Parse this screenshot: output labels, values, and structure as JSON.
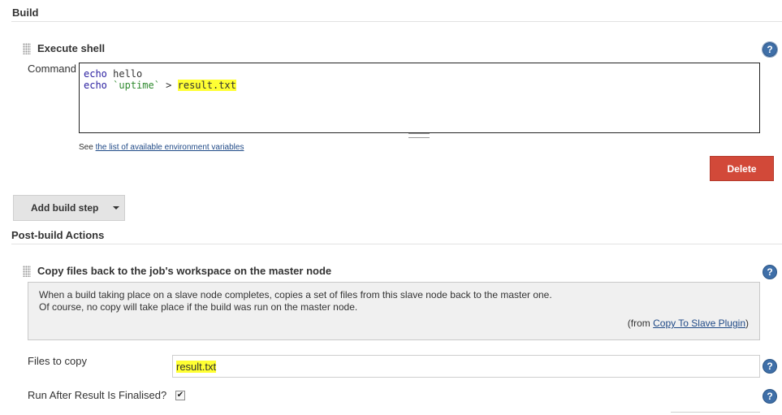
{
  "build": {
    "section_title": "Build",
    "step": {
      "title": "Execute shell",
      "command_label": "Command",
      "code": {
        "line1_cmd": "echo",
        "line1_arg": " hello",
        "line2_cmd": "echo",
        "line2_str": "`uptime`",
        "line2_op": " > ",
        "line2_file": "result.txt"
      },
      "hint_prefix": "See ",
      "hint_link": "the list of available environment variables",
      "delete_label": "Delete"
    },
    "add_step_label": "Add build step"
  },
  "post_build": {
    "section_title": "Post-build Actions",
    "action": {
      "title": "Copy files back to the job's workspace on the master node",
      "desc_line1": "When a build taking place on a slave node completes, copies a set of files from this slave node back to the master one.",
      "desc_line2": "Of course, no copy will take place if the build was run on the master node.",
      "from_prefix": "(from ",
      "from_link": "Copy To Slave Plugin",
      "from_suffix": ")",
      "files_label": "Files to copy",
      "files_value": "result.txt",
      "run_after_label": "Run After Result Is Finalised?",
      "run_after_checked": true
    }
  },
  "help_icon_glyph": "?",
  "checkmark_glyph": "✔",
  "colors": {
    "delete_red": "#d24939",
    "highlight_yellow": "#ffff33",
    "help_blue": "#3f6fa8"
  }
}
